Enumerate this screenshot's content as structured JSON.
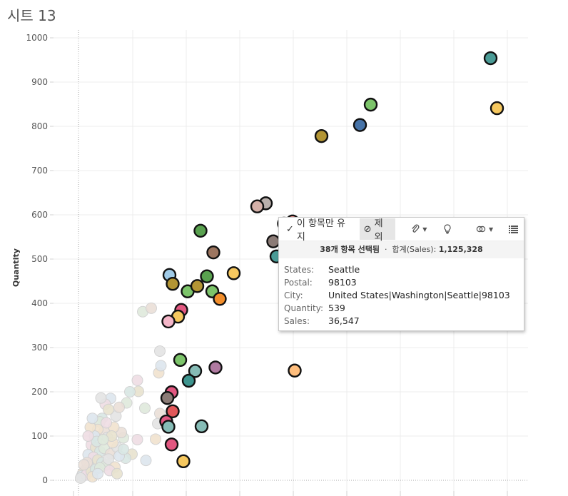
{
  "sheet_title": "시트 13",
  "chart_data": {
    "type": "scatter",
    "ylabel": "Quantity",
    "xlabel": "",
    "ylim": [
      0,
      1000
    ],
    "yticks": [
      0,
      100,
      200,
      300,
      400,
      500,
      600,
      700,
      800,
      900,
      1000
    ],
    "grid": true,
    "selected_points": [
      {
        "x": 385,
        "y": 954,
        "color": "#4a9b96"
      },
      {
        "x": 391,
        "y": 841,
        "color": "#f6c85f"
      },
      {
        "x": 273,
        "y": 849,
        "color": "#7cc46a"
      },
      {
        "x": 263,
        "y": 803,
        "color": "#4673a8"
      },
      {
        "x": 227,
        "y": 778,
        "color": "#b39534"
      },
      {
        "x": 175,
        "y": 626,
        "color": "#bab0ac"
      },
      {
        "x": 167,
        "y": 619,
        "color": "#d4b0a8"
      },
      {
        "x": 200,
        "y": 585,
        "color": "#ff9d9a"
      },
      {
        "x": 192,
        "y": 580,
        "color": "#4f8f8a"
      },
      {
        "x": 182,
        "y": 540,
        "color": "#8b7b76"
      },
      {
        "x": 185,
        "y": 506,
        "color": "#4a9b96"
      },
      {
        "x": 114,
        "y": 564,
        "color": "#59a14f"
      },
      {
        "x": 126,
        "y": 515,
        "color": "#9c755f"
      },
      {
        "x": 145,
        "y": 468,
        "color": "#f6c85f"
      },
      {
        "x": 85,
        "y": 464,
        "color": "#a0cbe8"
      },
      {
        "x": 88,
        "y": 444,
        "color": "#b39534"
      },
      {
        "x": 120,
        "y": 461,
        "color": "#59a14f"
      },
      {
        "x": 102,
        "y": 427,
        "color": "#7cc46a"
      },
      {
        "x": 111,
        "y": 439,
        "color": "#b39534"
      },
      {
        "x": 125,
        "y": 427,
        "color": "#7cc46a"
      },
      {
        "x": 132,
        "y": 410,
        "color": "#f28e2b"
      },
      {
        "x": 96,
        "y": 385,
        "color": "#e15780"
      },
      {
        "x": 93,
        "y": 370,
        "color": "#f6c85f"
      },
      {
        "x": 84,
        "y": 359,
        "color": "#f4b6c8"
      },
      {
        "x": 202,
        "y": 248,
        "color": "#ffbe7d"
      },
      {
        "x": 95,
        "y": 272,
        "color": "#7cc46a"
      },
      {
        "x": 109,
        "y": 247,
        "color": "#86bcb6"
      },
      {
        "x": 128,
        "y": 255,
        "color": "#b07aa1"
      },
      {
        "x": 103,
        "y": 225,
        "color": "#3d948e"
      },
      {
        "x": 87,
        "y": 199,
        "color": "#e15780"
      },
      {
        "x": 83,
        "y": 186,
        "color": "#8b7b76"
      },
      {
        "x": 88,
        "y": 156,
        "color": "#e15759"
      },
      {
        "x": 82,
        "y": 133,
        "color": "#e15780"
      },
      {
        "x": 84,
        "y": 121,
        "color": "#86bcb6"
      },
      {
        "x": 115,
        "y": 122,
        "color": "#86bcb6"
      },
      {
        "x": 87,
        "y": 81,
        "color": "#e15780"
      },
      {
        "x": 98,
        "y": 43,
        "color": "#f6c85f"
      },
      {
        "x": 193,
        "y": 577,
        "color": "#4a9b96"
      }
    ],
    "unselected_points": [
      {
        "x": 60,
        "y": 381
      },
      {
        "x": 68,
        "y": 389
      },
      {
        "x": 76,
        "y": 292
      },
      {
        "x": 75,
        "y": 243
      },
      {
        "x": 77,
        "y": 259
      },
      {
        "x": 55,
        "y": 226
      },
      {
        "x": 56,
        "y": 201
      },
      {
        "x": 48,
        "y": 200
      },
      {
        "x": 62,
        "y": 163
      },
      {
        "x": 76,
        "y": 151
      },
      {
        "x": 74,
        "y": 128
      },
      {
        "x": 72,
        "y": 93
      },
      {
        "x": 63,
        "y": 45
      },
      {
        "x": 55,
        "y": 92
      },
      {
        "x": 50,
        "y": 59
      },
      {
        "x": 44,
        "y": 50
      },
      {
        "x": 42,
        "y": 96
      },
      {
        "x": 40,
        "y": 108
      },
      {
        "x": 35,
        "y": 145
      },
      {
        "x": 33,
        "y": 120
      },
      {
        "x": 30,
        "y": 185
      },
      {
        "x": 25,
        "y": 172
      },
      {
        "x": 28,
        "y": 160
      },
      {
        "x": 22,
        "y": 140
      },
      {
        "x": 20,
        "y": 132
      },
      {
        "x": 24,
        "y": 110
      },
      {
        "x": 27,
        "y": 97
      },
      {
        "x": 18,
        "y": 115
      },
      {
        "x": 15,
        "y": 100
      },
      {
        "x": 12,
        "y": 80
      },
      {
        "x": 16,
        "y": 74
      },
      {
        "x": 20,
        "y": 65
      },
      {
        "x": 24,
        "y": 72
      },
      {
        "x": 30,
        "y": 60
      },
      {
        "x": 36,
        "y": 75
      },
      {
        "x": 32,
        "y": 85
      },
      {
        "x": 9,
        "y": 58
      },
      {
        "x": 14,
        "y": 52
      },
      {
        "x": 18,
        "y": 46
      },
      {
        "x": 22,
        "y": 40
      },
      {
        "x": 26,
        "y": 35
      },
      {
        "x": 10,
        "y": 30
      },
      {
        "x": 6,
        "y": 22
      },
      {
        "x": 4,
        "y": 16
      },
      {
        "x": 3,
        "y": 10
      },
      {
        "x": 7,
        "y": 12
      },
      {
        "x": 12,
        "y": 20
      },
      {
        "x": 16,
        "y": 25
      },
      {
        "x": 20,
        "y": 28
      },
      {
        "x": 8,
        "y": 40
      },
      {
        "x": 28,
        "y": 48
      },
      {
        "x": 34,
        "y": 30
      },
      {
        "x": 38,
        "y": 55
      },
      {
        "x": 26,
        "y": 130
      },
      {
        "x": 31,
        "y": 100
      },
      {
        "x": 17,
        "y": 88
      },
      {
        "x": 23,
        "y": 92
      },
      {
        "x": 5,
        "y": 35
      },
      {
        "x": 2,
        "y": 5
      },
      {
        "x": 13,
        "y": 8
      },
      {
        "x": 18,
        "y": 15
      },
      {
        "x": 29,
        "y": 22
      },
      {
        "x": 36,
        "y": 15
      },
      {
        "x": 42,
        "y": 70
      },
      {
        "x": 45,
        "y": 175
      },
      {
        "x": 38,
        "y": 165
      },
      {
        "x": 21,
        "y": 186
      },
      {
        "x": 11,
        "y": 120
      },
      {
        "x": 13,
        "y": 140
      },
      {
        "x": 9,
        "y": 100
      }
    ]
  },
  "tooltip": {
    "toolbar": {
      "keep_icon": "check-icon",
      "keep_label": "이 항목만 유지",
      "exclude_icon": "ban-icon",
      "exclude_label": "제외",
      "icons": [
        "paperclip-icon",
        "lightbulb-icon",
        "link-icon",
        "grid-icon"
      ]
    },
    "summary": {
      "count": "38개 항목 선택됨",
      "sep": "·",
      "sum_label": "합계(Sales):",
      "sum_value": "1,125,328"
    },
    "fields": [
      {
        "key": "States:",
        "value": "Seattle"
      },
      {
        "key": "Postal:",
        "value": "98103"
      },
      {
        "key": "City:",
        "value": "United States|Washington|Seattle|98103"
      },
      {
        "key": "Quantity:",
        "value": "539"
      },
      {
        "key": "Sales:",
        "value": "36,547"
      }
    ]
  }
}
